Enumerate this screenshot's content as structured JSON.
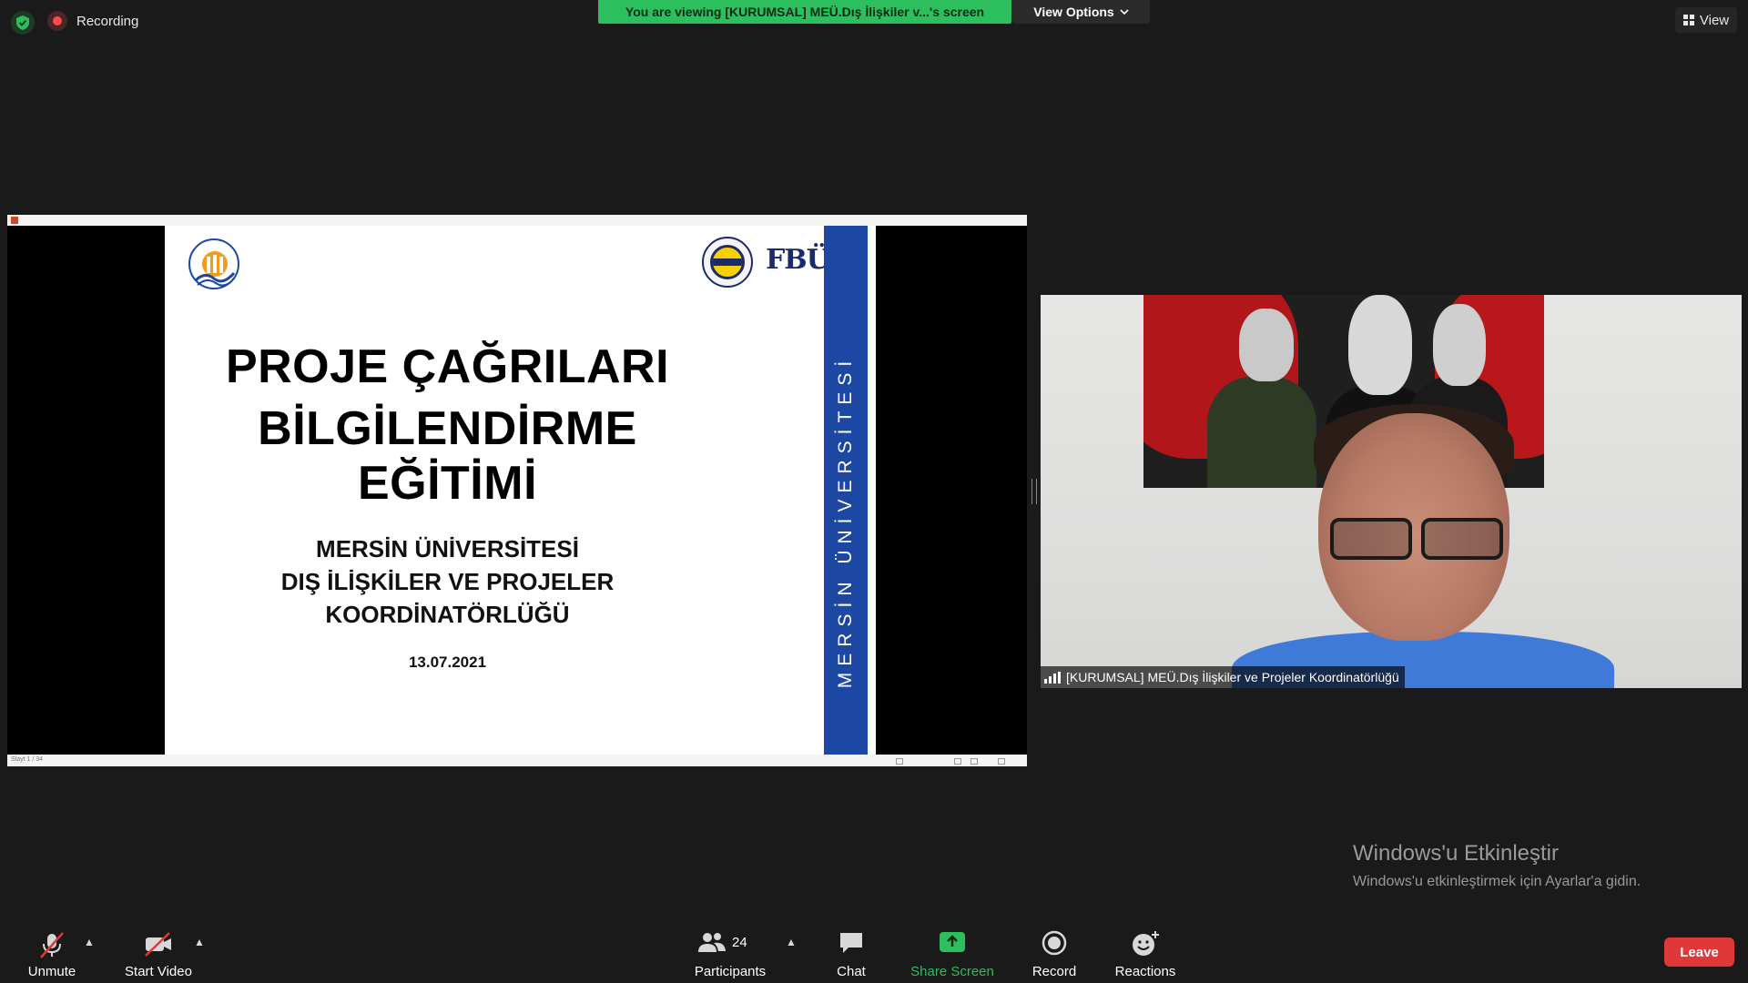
{
  "top_bar": {
    "recording_label": "Recording",
    "viewing_banner": "You are viewing [KURUMSAL] MEÜ.Dış İlişkiler v...'s screen",
    "view_options_label": "View Options",
    "view_label": "View"
  },
  "shared_screen": {
    "status_text": "Slayt 1 / 34",
    "slide": {
      "title_line1": "PROJE ÇAĞRILARI",
      "title_line2": "BİLGİLENDİRME EĞİTİMİ",
      "subtitle_line1": "MERSİN ÜNİVERSİTESİ",
      "subtitle_line2": "DIŞ İLİŞKİLER VE PROJELER",
      "subtitle_line3": "KOORDİNATÖRLÜĞÜ",
      "date": "13.07.2021",
      "side_band_text": "MERSİN ÜNİVERSİTESİ",
      "logo_right_text": "FBÜ"
    }
  },
  "video_tile": {
    "participant_name": "[KURUMSAL] MEÜ.Dış İlişkiler ve Projeler Koordinatörlüğü"
  },
  "watermark": {
    "title": "Windows'u Etkinleştir",
    "subtitle": "Windows'u etkinleştirmek için Ayarlar'a gidin."
  },
  "toolbar": {
    "unmute_label": "Unmute",
    "start_video_label": "Start Video",
    "participants_label": "Participants",
    "participants_count": "24",
    "chat_label": "Chat",
    "share_screen_label": "Share Screen",
    "record_label": "Record",
    "reactions_label": "Reactions",
    "leave_label": "Leave"
  },
  "colors": {
    "banner_green": "#2dbe5e",
    "leave_red": "#e03838",
    "slide_blue": "#1c47a3"
  }
}
